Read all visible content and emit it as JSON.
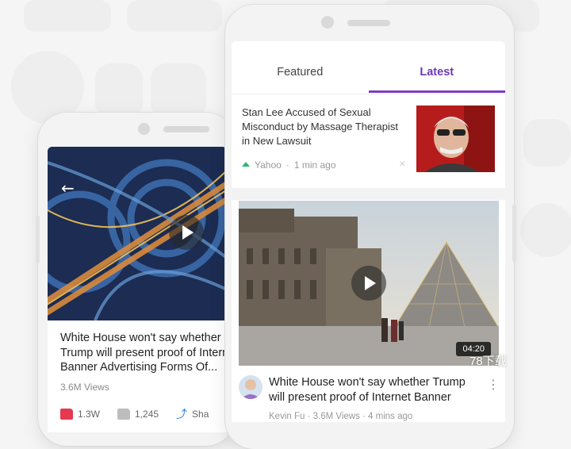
{
  "background": {
    "color": "#f5f5f5"
  },
  "left_phone": {
    "video_title": "White House won't say whether Trump will present proof of Internet Banner Advertising Forms Of...",
    "views": "3.6M Views",
    "actions": {
      "likes": "1.3W",
      "comments": "1,245",
      "share_label": "Sha"
    }
  },
  "right_phone": {
    "tabs": [
      {
        "label": "Featured",
        "active": false
      },
      {
        "label": "Latest",
        "active": true
      }
    ],
    "article": {
      "title": "Stan Lee Accused of Sexual Misconduct by Massage Therapist in New Lawsuit",
      "source": "Yahoo",
      "time": "1 min ago",
      "separator": "·"
    },
    "video": {
      "duration": "04:20",
      "title": "White House won't say whether Trump will present proof of Internet Banner",
      "meta": "Kevin Fu · 3.6M Views · 4 mins ago"
    }
  },
  "watermark": "78下载",
  "colors": {
    "accent": "#7b3fc4",
    "like": "#e53950",
    "trending": "#2bb673"
  }
}
